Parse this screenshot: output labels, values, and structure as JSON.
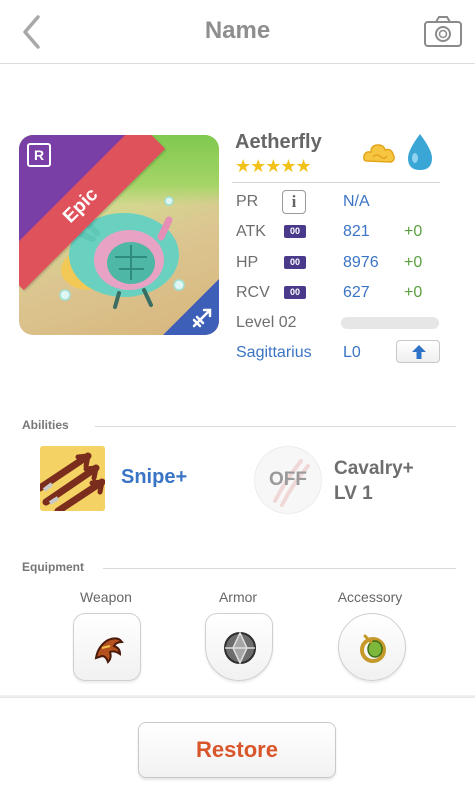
{
  "header": {
    "title": "Name",
    "back_icon": "chevron-left-icon",
    "camera_icon": "camera-icon"
  },
  "monster": {
    "name": "Aetherfly",
    "rarity": "Epic",
    "rank_badge": "R",
    "stars": "★★★★★",
    "star_count": 5,
    "elements": [
      "cloud-element-icon",
      "water-element-icon"
    ],
    "class_icon": "archer-class-icon",
    "colors": {
      "rarity_ribbon": "#e0525b",
      "rank_corner": "#7a3fa6",
      "class_corner": "#3d5fb8"
    }
  },
  "stats": {
    "pr": {
      "label": "PR",
      "value": "N/A"
    },
    "atk": {
      "label": "ATK",
      "pill": "00",
      "value": "821",
      "bonus": "+0"
    },
    "hp": {
      "label": "HP",
      "pill": "00",
      "value": "8976",
      "bonus": "+0"
    },
    "rcv": {
      "label": "RCV",
      "pill": "00",
      "value": "627",
      "bonus": "+0"
    },
    "level": {
      "label": "Level 02",
      "progress": 0.0
    },
    "constellation": {
      "label": "Sagittarius",
      "value": "L0"
    }
  },
  "abilities": {
    "title": "Abilities",
    "active": {
      "name": "Snipe+",
      "icon": "snipe-arrows-icon"
    },
    "passive": {
      "state": "OFF",
      "name": "Cavalry+",
      "level": "LV 1",
      "icon": "claw-marks-icon"
    }
  },
  "equipment": {
    "title": "Equipment",
    "weapon": {
      "label": "Weapon",
      "icon": "claw-weapon-icon"
    },
    "armor": {
      "label": "Armor",
      "icon": "gem-armor-icon"
    },
    "accessory": {
      "label": "Accessory",
      "icon": "emerald-ring-icon"
    }
  },
  "footer": {
    "restore_label": "Restore",
    "accent": "#d9552a"
  }
}
